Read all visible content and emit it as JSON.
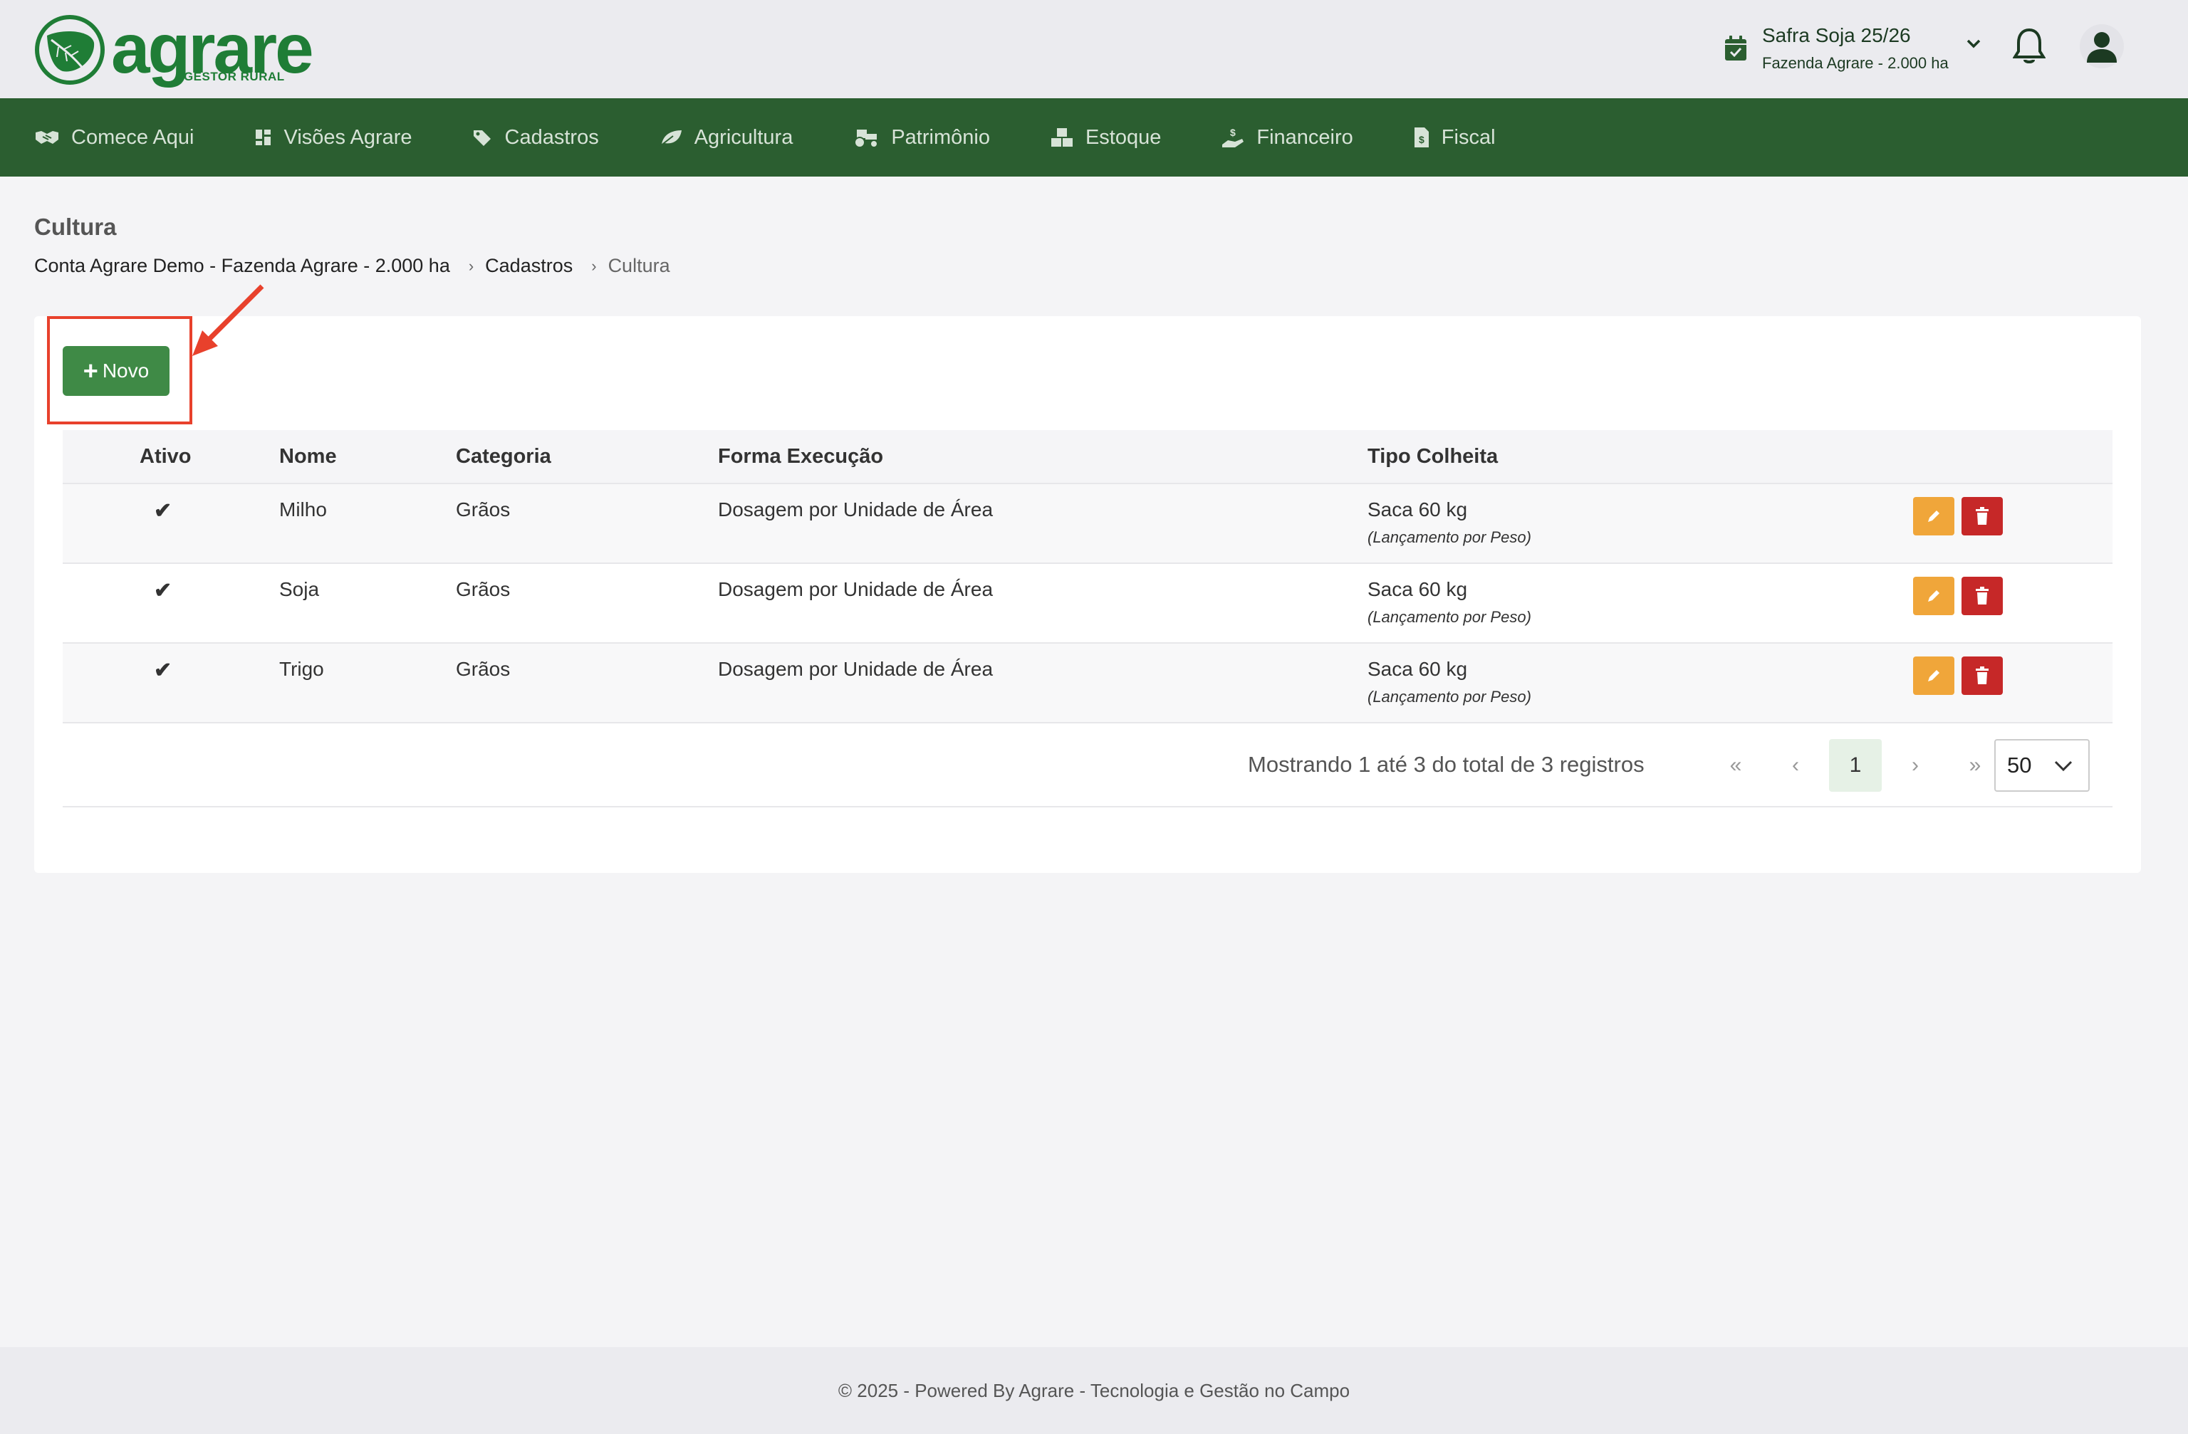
{
  "header": {
    "logo_text": "agrare",
    "logo_tagline": "GESTOR RURAL",
    "safra_title": "Safra Soja 25/26",
    "safra_subtitle": "Fazenda Agrare - 2.000 ha"
  },
  "nav": {
    "items": [
      {
        "label": "Comece Aqui",
        "icon": "handshake-icon"
      },
      {
        "label": "Visões Agrare",
        "icon": "dashboard-icon"
      },
      {
        "label": "Cadastros",
        "icon": "tag-icon"
      },
      {
        "label": "Agricultura",
        "icon": "leaf-icon"
      },
      {
        "label": "Patrimônio",
        "icon": "tractor-icon"
      },
      {
        "label": "Estoque",
        "icon": "boxes-icon"
      },
      {
        "label": "Financeiro",
        "icon": "hand-money-icon"
      },
      {
        "label": "Fiscal",
        "icon": "invoice-icon"
      }
    ]
  },
  "page": {
    "title": "Cultura",
    "breadcrumb": [
      "Conta Agrare Demo - Fazenda Agrare - 2.000 ha",
      "Cadastros",
      "Cultura"
    ]
  },
  "toolbar": {
    "new_label": "Novo"
  },
  "table": {
    "columns": [
      "Ativo",
      "Nome",
      "Categoria",
      "Forma Execução",
      "Tipo Colheita"
    ],
    "rows": [
      {
        "ativo": "✔",
        "nome": "Milho",
        "categoria": "Grãos",
        "forma": "Dosagem por Unidade de Área",
        "tipo": "Saca 60 kg",
        "tipo_sub": "(Lançamento por Peso)"
      },
      {
        "ativo": "✔",
        "nome": "Soja",
        "categoria": "Grãos",
        "forma": "Dosagem por Unidade de Área",
        "tipo": "Saca 60 kg",
        "tipo_sub": "(Lançamento por Peso)"
      },
      {
        "ativo": "✔",
        "nome": "Trigo",
        "categoria": "Grãos",
        "forma": "Dosagem por Unidade de Área",
        "tipo": "Saca 60 kg",
        "tipo_sub": "(Lançamento por Peso)"
      }
    ]
  },
  "pagination": {
    "info": "Mostrando 1 até 3 do total de 3 registros",
    "first": "«",
    "prev": "‹",
    "current_page": "1",
    "next": "›",
    "last": "»",
    "page_size": "50"
  },
  "footer": {
    "text": "© 2025 - Powered By Agrare - Tecnologia e Gestão no Campo"
  },
  "colors": {
    "brand_green": "#1f7d36",
    "nav_green": "#2b5e30",
    "button_green": "#3f8a46",
    "edit_orange": "#f0a63a",
    "delete_red": "#c62828",
    "annotation_red": "#e8412c"
  }
}
